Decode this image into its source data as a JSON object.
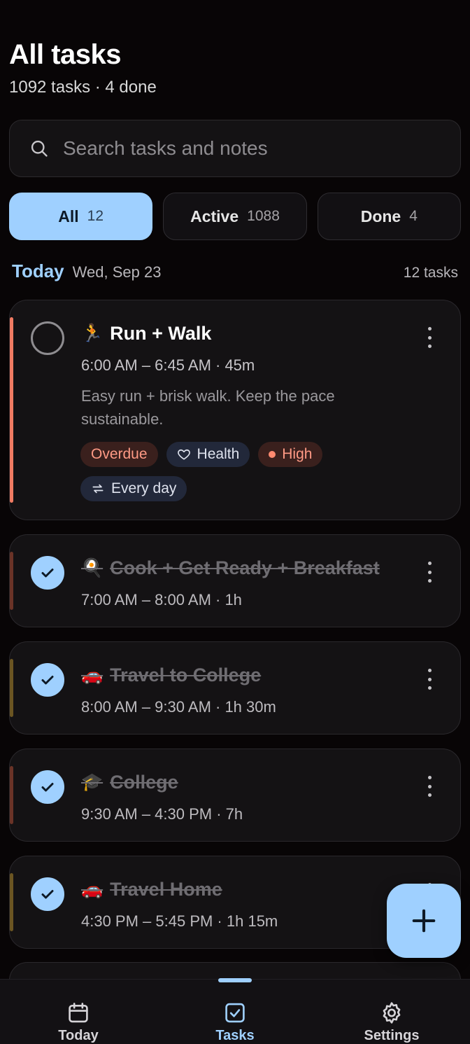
{
  "header": {
    "title": "All tasks",
    "subtitle": "1092 tasks · 4 done"
  },
  "search": {
    "placeholder": "Search tasks and notes",
    "icon": "search-icon"
  },
  "filters": [
    {
      "label": "All",
      "count": "12",
      "selected": true
    },
    {
      "label": "Active",
      "count": "1088",
      "selected": false
    },
    {
      "label": "Done",
      "count": "4",
      "selected": false
    }
  ],
  "section": {
    "title": "Today",
    "date": "Wed, Sep 23",
    "count": "12 tasks"
  },
  "tasks": [
    {
      "emoji": "🏃",
      "title": "Run + Walk",
      "time": "6:00 AM – 6:45 AM · 45m",
      "notes": "Easy run + brisk walk. Keep the pace sustainable.",
      "done": false,
      "accent_color": "#f07b63",
      "tags": [
        {
          "label": "Overdue",
          "kind": "overdue"
        },
        {
          "label": "Health",
          "kind": "health",
          "icon": "heart-icon"
        },
        {
          "label": "High",
          "kind": "high"
        },
        {
          "label": "Every day",
          "kind": "repeat",
          "icon": "repeat-icon"
        }
      ]
    },
    {
      "emoji": "🍳",
      "title": "Cook + Get Ready + Breakfast",
      "time": "7:00 AM – 8:00 AM · 1h",
      "done": true,
      "accent_color": "#6a3327"
    },
    {
      "emoji": "🚗",
      "title": "Travel to College",
      "time": "8:00 AM – 9:30 AM · 1h 30m",
      "done": true,
      "accent_color": "#6b5522"
    },
    {
      "emoji": "🎓",
      "title": "College",
      "time": "9:30 AM – 4:30 PM · 7h",
      "done": true,
      "accent_color": "#6a3327"
    },
    {
      "emoji": "🚗",
      "title": "Travel Home",
      "time": "4:30 PM – 5:45 PM · 1h 15m",
      "done": true,
      "accent_color": "#6b5522"
    }
  ],
  "fab": {
    "icon": "plus-icon"
  },
  "nav": [
    {
      "label": "Today",
      "icon": "calendar-icon",
      "active": false
    },
    {
      "label": "Tasks",
      "icon": "task-check-icon",
      "active": true
    },
    {
      "label": "Settings",
      "icon": "gear-icon",
      "active": false
    }
  ],
  "colors": {
    "accent": "#9fd0ff",
    "background": "#080506",
    "card": "#141214",
    "overdue": "#ff9a85"
  }
}
